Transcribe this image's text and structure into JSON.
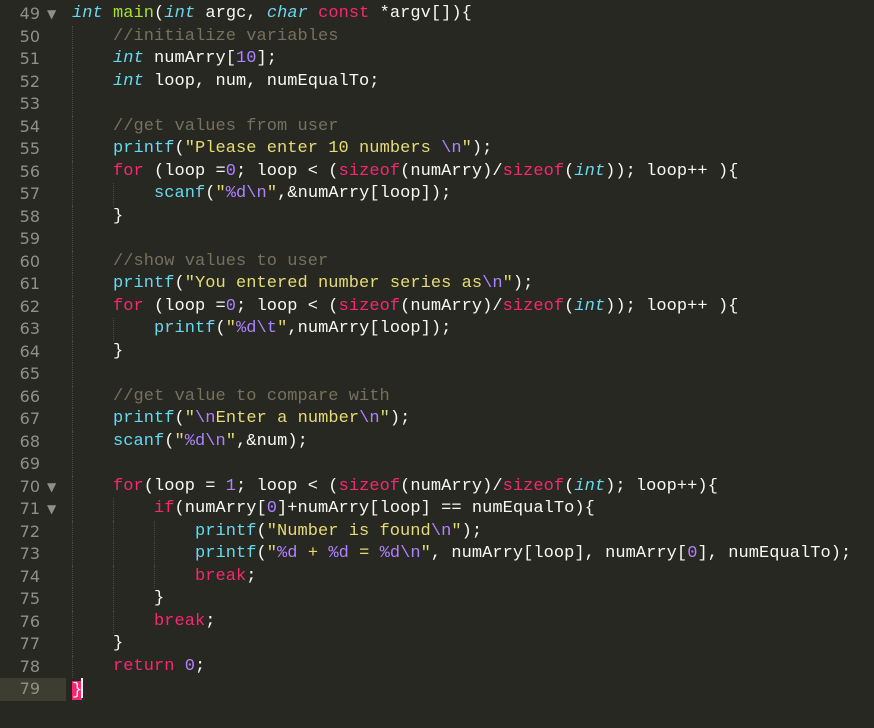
{
  "editor": {
    "theme": "monokai",
    "colors": {
      "background": "#272822",
      "line_number": "#90908a",
      "current_line_gutter": "#3e3d32",
      "keyword": "#f92672",
      "type": "#66d9ef",
      "function_def": "#a6e22e",
      "function_call": "#66d9ef",
      "string": "#e6db74",
      "escape_constant": "#ae81ff",
      "comment": "#75715e",
      "plain": "#f8f8f2",
      "bracket_match_bg": "#f92672"
    },
    "current_line": 79,
    "lines": [
      {
        "n": "49",
        "fold": "▼",
        "indent": 0,
        "tokens": [
          [
            "type",
            "int"
          ],
          [
            "pl",
            " "
          ],
          [
            "fn",
            "main"
          ],
          [
            "pl",
            "("
          ],
          [
            "type",
            "int"
          ],
          [
            "pl",
            " argc, "
          ],
          [
            "type",
            "char"
          ],
          [
            "pl",
            " "
          ],
          [
            "kw",
            "const"
          ],
          [
            "pl",
            " *argv[]){"
          ]
        ]
      },
      {
        "n": "50",
        "fold": "",
        "indent": 1,
        "tokens": [
          [
            "cmt",
            "//initialize variables"
          ]
        ]
      },
      {
        "n": "51",
        "fold": "",
        "indent": 1,
        "tokens": [
          [
            "type",
            "int"
          ],
          [
            "pl",
            " numArry["
          ],
          [
            "num",
            "10"
          ],
          [
            "pl",
            "];"
          ]
        ]
      },
      {
        "n": "52",
        "fold": "",
        "indent": 1,
        "tokens": [
          [
            "type",
            "int"
          ],
          [
            "pl",
            " loop, num, numEqualTo;"
          ]
        ]
      },
      {
        "n": "53",
        "fold": "",
        "indent": 1,
        "tokens": []
      },
      {
        "n": "54",
        "fold": "",
        "indent": 1,
        "tokens": [
          [
            "cmt",
            "//get values from user"
          ]
        ]
      },
      {
        "n": "55",
        "fold": "",
        "indent": 1,
        "tokens": [
          [
            "call",
            "printf"
          ],
          [
            "pl",
            "("
          ],
          [
            "str",
            "\"Please enter 10 numbers "
          ],
          [
            "esc",
            "\\n"
          ],
          [
            "str",
            "\""
          ],
          [
            "pl",
            ");"
          ]
        ]
      },
      {
        "n": "56",
        "fold": "",
        "indent": 1,
        "tokens": [
          [
            "kw",
            "for"
          ],
          [
            "pl",
            " (loop ="
          ],
          [
            "num",
            "0"
          ],
          [
            "pl",
            "; loop < ("
          ],
          [
            "kw",
            "sizeof"
          ],
          [
            "pl",
            "(numArry)/"
          ],
          [
            "kw",
            "sizeof"
          ],
          [
            "pl",
            "("
          ],
          [
            "type",
            "int"
          ],
          [
            "pl",
            ")); loop++ ){"
          ]
        ]
      },
      {
        "n": "57",
        "fold": "",
        "indent": 2,
        "tokens": [
          [
            "call",
            "scanf"
          ],
          [
            "pl",
            "("
          ],
          [
            "str",
            "\""
          ],
          [
            "esc",
            "%d\\n"
          ],
          [
            "str",
            "\""
          ],
          [
            "pl",
            ",&numArry[loop]);"
          ]
        ]
      },
      {
        "n": "58",
        "fold": "",
        "indent": 1,
        "tokens": [
          [
            "pl",
            "}"
          ]
        ]
      },
      {
        "n": "59",
        "fold": "",
        "indent": 1,
        "tokens": []
      },
      {
        "n": "60",
        "fold": "",
        "indent": 1,
        "tokens": [
          [
            "cmt",
            "//show values to user"
          ]
        ]
      },
      {
        "n": "61",
        "fold": "",
        "indent": 1,
        "tokens": [
          [
            "call",
            "printf"
          ],
          [
            "pl",
            "("
          ],
          [
            "str",
            "\"You entered number series as"
          ],
          [
            "esc",
            "\\n"
          ],
          [
            "str",
            "\""
          ],
          [
            "pl",
            ");"
          ]
        ]
      },
      {
        "n": "62",
        "fold": "",
        "indent": 1,
        "tokens": [
          [
            "kw",
            "for"
          ],
          [
            "pl",
            " (loop ="
          ],
          [
            "num",
            "0"
          ],
          [
            "pl",
            "; loop < ("
          ],
          [
            "kw",
            "sizeof"
          ],
          [
            "pl",
            "(numArry)/"
          ],
          [
            "kw",
            "sizeof"
          ],
          [
            "pl",
            "("
          ],
          [
            "type",
            "int"
          ],
          [
            "pl",
            ")); loop++ ){"
          ]
        ]
      },
      {
        "n": "63",
        "fold": "",
        "indent": 2,
        "tokens": [
          [
            "call",
            "printf"
          ],
          [
            "pl",
            "("
          ],
          [
            "str",
            "\""
          ],
          [
            "esc",
            "%d\\t"
          ],
          [
            "str",
            "\""
          ],
          [
            "pl",
            ",numArry[loop]);"
          ]
        ]
      },
      {
        "n": "64",
        "fold": "",
        "indent": 1,
        "tokens": [
          [
            "pl",
            "}"
          ]
        ]
      },
      {
        "n": "65",
        "fold": "",
        "indent": 1,
        "tokens": []
      },
      {
        "n": "66",
        "fold": "",
        "indent": 1,
        "tokens": [
          [
            "cmt",
            "//get value to compare with"
          ]
        ]
      },
      {
        "n": "67",
        "fold": "",
        "indent": 1,
        "tokens": [
          [
            "call",
            "printf"
          ],
          [
            "pl",
            "("
          ],
          [
            "str",
            "\""
          ],
          [
            "esc",
            "\\n"
          ],
          [
            "str",
            "Enter a number"
          ],
          [
            "esc",
            "\\n"
          ],
          [
            "str",
            "\""
          ],
          [
            "pl",
            ");"
          ]
        ]
      },
      {
        "n": "68",
        "fold": "",
        "indent": 1,
        "tokens": [
          [
            "call",
            "scanf"
          ],
          [
            "pl",
            "("
          ],
          [
            "str",
            "\""
          ],
          [
            "esc",
            "%d\\n"
          ],
          [
            "str",
            "\""
          ],
          [
            "pl",
            ",&num);"
          ]
        ]
      },
      {
        "n": "69",
        "fold": "",
        "indent": 1,
        "tokens": []
      },
      {
        "n": "70",
        "fold": "▼",
        "indent": 1,
        "tokens": [
          [
            "kw",
            "for"
          ],
          [
            "pl",
            "(loop = "
          ],
          [
            "num",
            "1"
          ],
          [
            "pl",
            "; loop < ("
          ],
          [
            "kw",
            "sizeof"
          ],
          [
            "pl",
            "(numArry)/"
          ],
          [
            "kw",
            "sizeof"
          ],
          [
            "pl",
            "("
          ],
          [
            "type",
            "int"
          ],
          [
            "pl",
            "); loop++){"
          ]
        ]
      },
      {
        "n": "71",
        "fold": "▼",
        "indent": 2,
        "tokens": [
          [
            "kw",
            "if"
          ],
          [
            "pl",
            "(numArry["
          ],
          [
            "num",
            "0"
          ],
          [
            "pl",
            "]+numArry[loop] == numEqualTo){"
          ]
        ]
      },
      {
        "n": "72",
        "fold": "",
        "indent": 3,
        "tokens": [
          [
            "call",
            "printf"
          ],
          [
            "pl",
            "("
          ],
          [
            "str",
            "\"Number is found"
          ],
          [
            "esc",
            "\\n"
          ],
          [
            "str",
            "\""
          ],
          [
            "pl",
            ");"
          ]
        ]
      },
      {
        "n": "73",
        "fold": "",
        "indent": 3,
        "tokens": [
          [
            "call",
            "printf"
          ],
          [
            "pl",
            "("
          ],
          [
            "str",
            "\""
          ],
          [
            "esc",
            "%d"
          ],
          [
            "str",
            " + "
          ],
          [
            "esc",
            "%d"
          ],
          [
            "str",
            " = "
          ],
          [
            "esc",
            "%d\\n"
          ],
          [
            "str",
            "\""
          ],
          [
            "pl",
            ", numArry[loop], numArry["
          ],
          [
            "num",
            "0"
          ],
          [
            "pl",
            "], numEqualTo);"
          ]
        ]
      },
      {
        "n": "74",
        "fold": "",
        "indent": 3,
        "tokens": [
          [
            "kw",
            "break"
          ],
          [
            "pl",
            ";"
          ]
        ]
      },
      {
        "n": "75",
        "fold": "",
        "indent": 2,
        "tokens": [
          [
            "pl",
            "}"
          ]
        ]
      },
      {
        "n": "76",
        "fold": "",
        "indent": 2,
        "tokens": [
          [
            "kw",
            "break"
          ],
          [
            "pl",
            ";"
          ]
        ]
      },
      {
        "n": "77",
        "fold": "",
        "indent": 1,
        "tokens": [
          [
            "pl",
            "}"
          ]
        ]
      },
      {
        "n": "78",
        "fold": "",
        "indent": 1,
        "tokens": [
          [
            "kw",
            "return"
          ],
          [
            "pl",
            " "
          ],
          [
            "num",
            "0"
          ],
          [
            "pl",
            ";"
          ]
        ]
      },
      {
        "n": "79",
        "fold": "",
        "indent": 0,
        "tokens": [
          [
            "match",
            "}"
          ]
        ]
      }
    ]
  }
}
